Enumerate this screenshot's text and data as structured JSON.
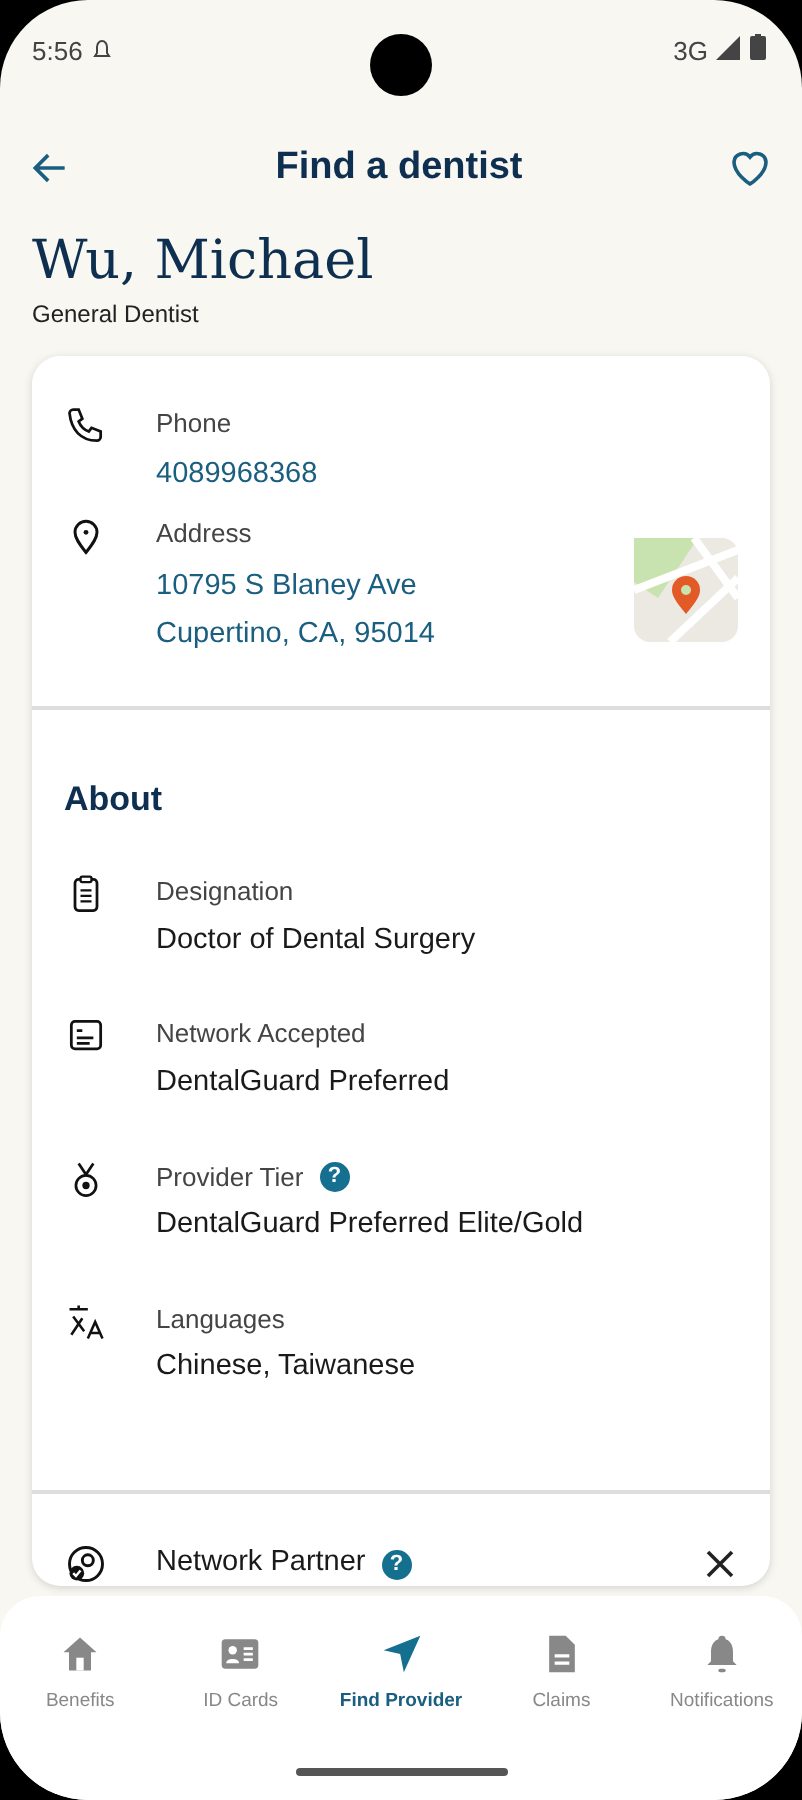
{
  "status_bar": {
    "time": "5:56",
    "network": "3G"
  },
  "header": {
    "title": "Find a dentist"
  },
  "provider": {
    "name": "Wu, Michael",
    "specialty": "General Dentist"
  },
  "contact": [
    {
      "label": "Phone",
      "lines": [
        "4089968368"
      ]
    },
    {
      "label": "Address",
      "lines": [
        "10795 S Blaney Ave",
        "Cupertino, CA, 95014"
      ]
    }
  ],
  "about": {
    "title": "About",
    "items": [
      {
        "label": "Designation",
        "value": "Doctor of Dental Surgery"
      },
      {
        "label": "Network Accepted",
        "value": "DentalGuard Preferred"
      },
      {
        "label": "Provider Tier",
        "help_mark": "?",
        "value": "DentalGuard Preferred Elite/Gold"
      },
      {
        "label": "Languages",
        "value": "Chinese, Taiwanese"
      }
    ]
  },
  "network_partner": {
    "label": "Network Partner",
    "help_mark": "?"
  },
  "bottom_nav": [
    {
      "label": "Benefits",
      "selected": false
    },
    {
      "label": "ID Cards",
      "selected": false
    },
    {
      "label": "Find Provider",
      "selected": true
    },
    {
      "label": "Claims",
      "selected": false
    },
    {
      "label": "Notifications",
      "selected": false
    }
  ]
}
